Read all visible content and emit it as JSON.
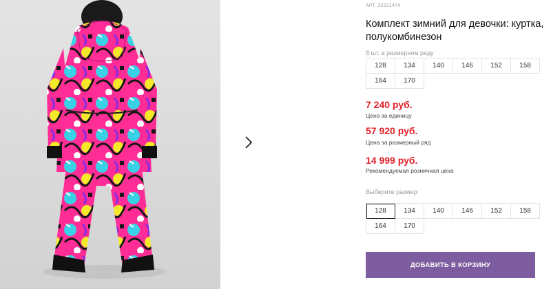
{
  "product": {
    "article": "АРТ. 32221474",
    "title": "Комплект зимний для девочки: куртка, полукомбинезон"
  },
  "size_row": {
    "label": "8 шт. в размерном ряду",
    "sizes": [
      "128",
      "134",
      "140",
      "146",
      "152",
      "158",
      "164",
      "170"
    ]
  },
  "prices": [
    {
      "value": "7 240 руб.",
      "note": "Цена за единицу"
    },
    {
      "value": "57 920 руб.",
      "note": "Цена за размерный ряд"
    },
    {
      "value": "14 999 руб.",
      "note": "Рекомендуемая розничная цена"
    }
  ],
  "size_picker": {
    "label": "Выберите размер:",
    "sizes": [
      "128",
      "134",
      "140",
      "146",
      "152",
      "158",
      "164",
      "170"
    ],
    "selected": "128"
  },
  "cart": {
    "button_label": "ДОБАВИТЬ В КОРЗИНУ"
  },
  "gallery": {
    "next_icon": "chevron-right-icon"
  },
  "colors": {
    "price": "#e3202a",
    "button": "#7d5c9f"
  }
}
